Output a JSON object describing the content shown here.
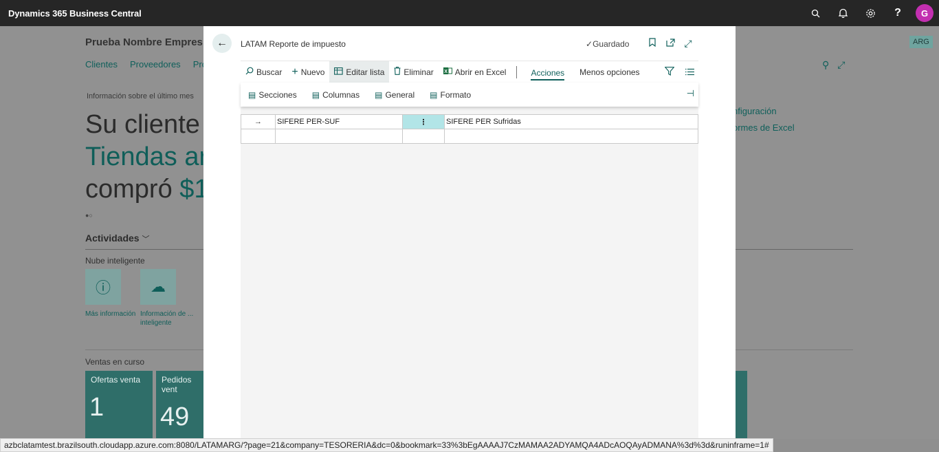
{
  "app": {
    "brand": "Dynamics 365 Business Central",
    "avatar_initial": "G",
    "icons": [
      "search-icon",
      "bell-icon",
      "gear-icon",
      "help-icon"
    ]
  },
  "background_page": {
    "company": "Prueba Nombre Empres",
    "nav": [
      "Clientes",
      "Proveedores",
      "Pro"
    ],
    "info_label": "Información sobre el último mes",
    "headline": {
      "line1": "Su cliente",
      "line2": "Tiendas ar",
      "line3_pre": "compró ",
      "line3_accent": "$1"
    },
    "dots": "●○",
    "actividades": "Actividades",
    "nube": "Nube inteligente",
    "tiles": [
      {
        "label_line1": "Más información",
        "label_line2": "",
        "icon": "info-icon"
      },
      {
        "label_line1": "Información de ...",
        "label_line2": "inteligente",
        "icon": "cloud-icon"
      }
    ],
    "ventas": "Ventas en curso",
    "cues": [
      {
        "title": "Ofertas venta",
        "value": "1"
      },
      {
        "title": "Pedidos vent",
        "value": "49"
      }
    ],
    "right_links": [
      "nfiguración",
      "ormes de Excel"
    ],
    "badge": "ARG"
  },
  "modal": {
    "title": "LATAM Reporte de impuesto",
    "saved_label": "Guardado",
    "toolbar": {
      "buscar": "Buscar",
      "nuevo": "Nuevo",
      "editar_lista": "Editar lista",
      "eliminar": "Eliminar",
      "abrir_excel": "Abrir en Excel",
      "acciones": "Acciones",
      "menos_opciones": "Menos opciones"
    },
    "subbar": {
      "secciones": "Secciones",
      "columnas": "Columnas",
      "general": "General",
      "formato": "Formato"
    },
    "rows": [
      {
        "indicator": "→",
        "code": "SIFERE PER-SUF",
        "description": "SIFERE PER Sufridas"
      },
      {
        "indicator": "",
        "code": "",
        "description": ""
      }
    ]
  },
  "status_url": "azbclatamtest.brazilsouth.cloudapp.azure.com:8080/LATAMARG/?page=21&company=TESORERIA&dc=0&bookmark=33%3bEgAAAAJ7CzMAMAA2ADYAMQA4ADcAOQAyADMANA%3d%3d&runinframe=1#"
}
